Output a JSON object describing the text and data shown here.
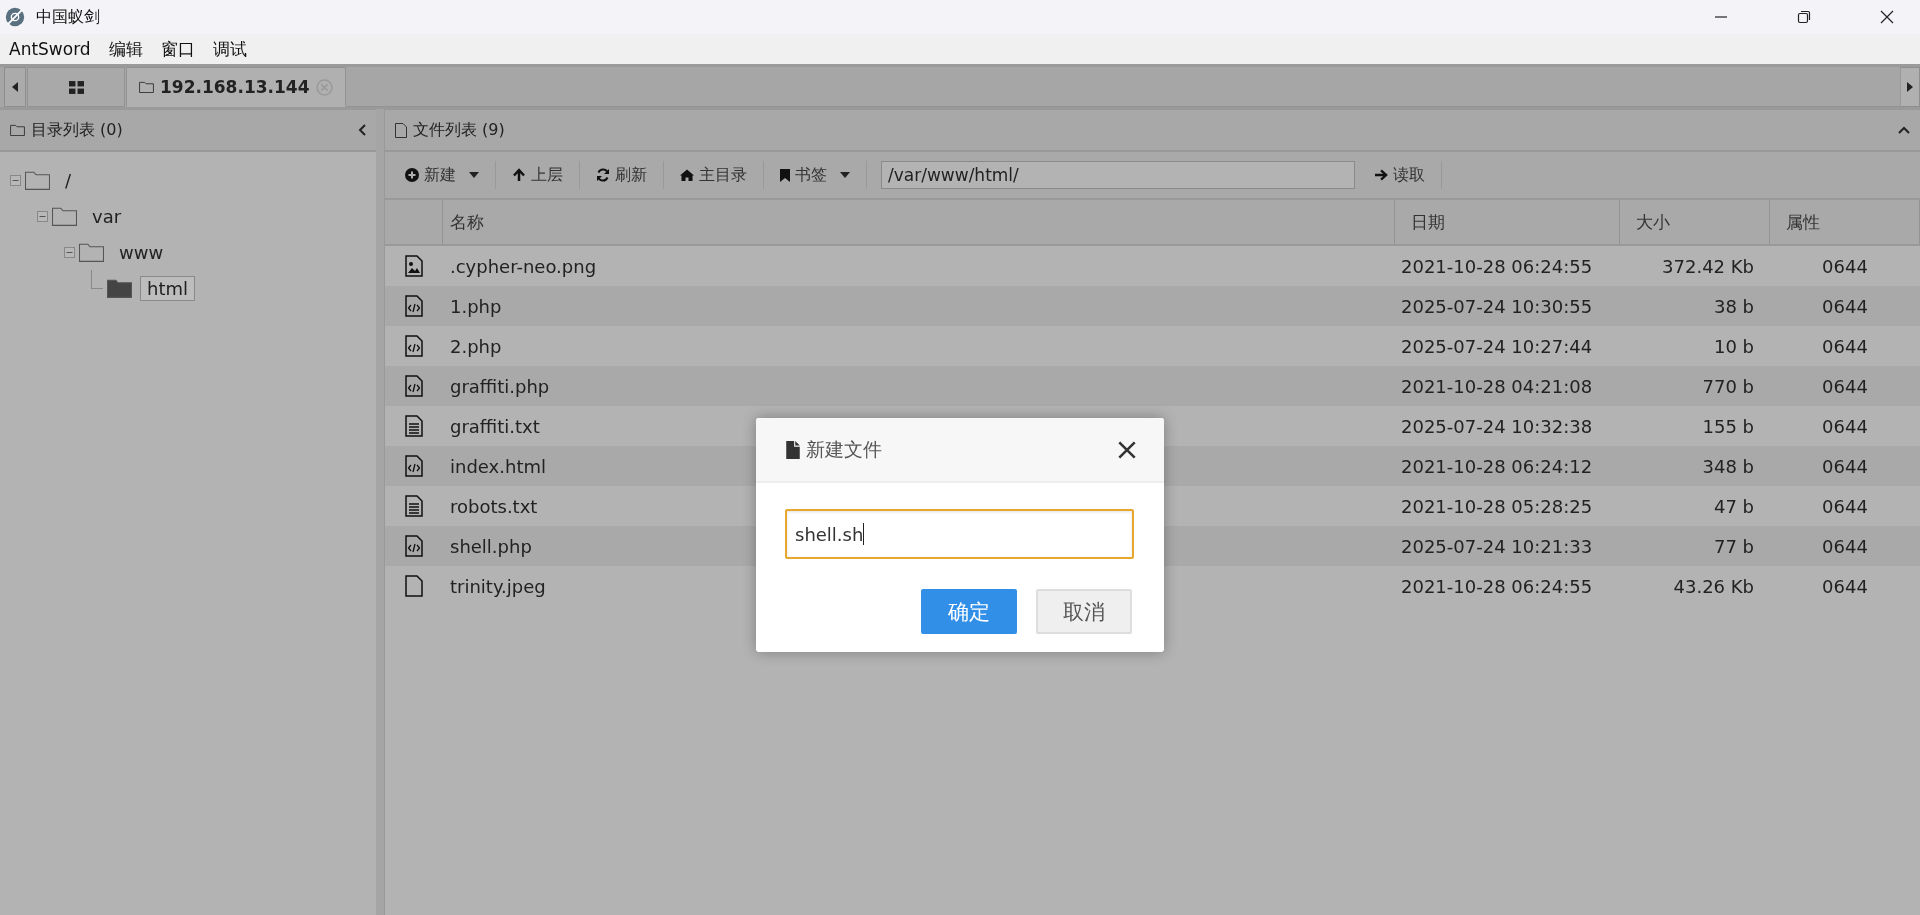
{
  "window": {
    "title": "中国蚁剑"
  },
  "menu": [
    "AntSword",
    "编辑",
    "窗口",
    "调试"
  ],
  "tabs": [
    {
      "kind": "grid",
      "selected": false
    },
    {
      "kind": "host",
      "label": "192.168.13.144",
      "selected": true
    }
  ],
  "dir_panel": {
    "title": "目录列表 (0)",
    "tree": [
      {
        "label": "/",
        "selected": false,
        "expanded": true,
        "children": [
          {
            "label": "var",
            "selected": false,
            "expanded": true,
            "children": [
              {
                "label": "www",
                "selected": false,
                "expanded": true,
                "children": [
                  {
                    "label": "html",
                    "selected": true
                  }
                ]
              }
            ]
          }
        ]
      }
    ]
  },
  "file_panel": {
    "title": "文件列表 (9)",
    "toolbar": [
      {
        "kind": "plus",
        "label": "新建",
        "dropdown": true
      },
      {
        "kind": "up",
        "label": "上层",
        "dropdown": false
      },
      {
        "kind": "refresh",
        "label": "刷新",
        "dropdown": false
      },
      {
        "kind": "home",
        "label": "主目录",
        "dropdown": false
      },
      {
        "kind": "bookmark",
        "label": "书签",
        "dropdown": true
      }
    ],
    "path": "/var/www/html/",
    "read_button": "读取",
    "columns": [
      "名称",
      "日期",
      "大小",
      "属性"
    ],
    "rows": [
      {
        "kind": "image",
        "name": ".cypher-neo.png",
        "date": "2021-10-28 06:24:55",
        "size": "372.42 Kb",
        "mode": "0644"
      },
      {
        "kind": "code",
        "name": "1.php",
        "date": "2025-07-24 10:30:55",
        "size": "38 b",
        "mode": "0644"
      },
      {
        "kind": "code",
        "name": "2.php",
        "date": "2025-07-24 10:27:44",
        "size": "10 b",
        "mode": "0644"
      },
      {
        "kind": "code",
        "name": "graffiti.php",
        "date": "2021-10-28 04:21:08",
        "size": "770 b",
        "mode": "0644"
      },
      {
        "kind": "text",
        "name": "graffiti.txt",
        "date": "2025-07-24 10:32:38",
        "size": "155 b",
        "mode": "0644"
      },
      {
        "kind": "code",
        "name": "index.html",
        "date": "2021-10-28 06:24:12",
        "size": "348 b",
        "mode": "0644"
      },
      {
        "kind": "text",
        "name": "robots.txt",
        "date": "2021-10-28 05:28:25",
        "size": "47 b",
        "mode": "0644"
      },
      {
        "kind": "code",
        "name": "shell.php",
        "date": "2025-07-24 10:21:33",
        "size": "77 b",
        "mode": "0644"
      },
      {
        "kind": "blank",
        "name": "trinity.jpeg",
        "date": "2021-10-28 06:24:55",
        "size": "43.26 Kb",
        "mode": "0644"
      }
    ]
  },
  "dialog": {
    "title": "新建文件",
    "value": "shell.sh",
    "buttons": [
      {
        "kind": "primary",
        "label": "确定"
      },
      {
        "kind": "default",
        "label": "取消"
      }
    ]
  }
}
